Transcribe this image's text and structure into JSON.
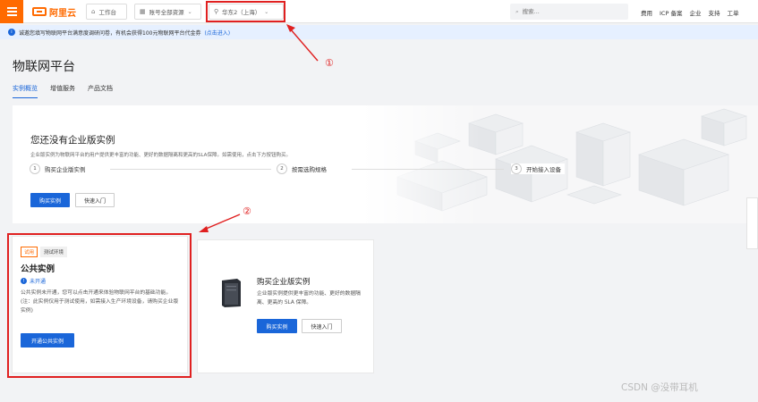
{
  "topbar": {
    "logo_text": "阿里云",
    "workbench": "工作台",
    "account_resources": "账号全部资源",
    "region": "华东2（上海）",
    "search_placeholder": "搜索...",
    "links": [
      "费用",
      "ICP 备案",
      "企业",
      "支持",
      "工单"
    ]
  },
  "notice": {
    "text": "诚邀您填写物联网平台满意度调研问卷，有机会获得100元物联网平台代金券",
    "link": "(点击进入)"
  },
  "page": {
    "title": "物联网平台",
    "tabs": [
      "实例概览",
      "增值服务",
      "产品文档"
    ]
  },
  "banner": {
    "title": "您还没有企业版实例",
    "desc": "企业版实例为物联网平台的用户提供更丰富的功能、更好的数据隔离和更高的SLA保障。如需使用，点击下方按钮购买。",
    "steps": [
      {
        "num": "1",
        "label": "购买企业版实例"
      },
      {
        "num": "2",
        "label": "按需选购规格"
      },
      {
        "num": "3",
        "label": "开始接入设备"
      }
    ],
    "buy_button": "购买实例",
    "quickstart_button": "快速入门"
  },
  "public_card": {
    "tag_trial": "试用",
    "tag_env": "测试环境",
    "title": "公共实例",
    "status": "未开通",
    "desc": "公共实例未开通，您可以点击开通来体验物联网平台的基础功能。(注：此实例仅用于测试使用，如需接入生产环境设备，请购买企业版实例)",
    "open_button": "开通公共实例"
  },
  "enterprise_card": {
    "title": "购买企业版实例",
    "desc": "企业版实例提供更丰富的功能、更好的数据隔离、更高的 SLA 保障。",
    "buy_button": "购买实例",
    "quickstart_button": "快速入门"
  },
  "annotations": {
    "one": "①",
    "two": "②"
  },
  "watermark": "CSDN @没带耳机",
  "colors": {
    "brand": "#ff6a00",
    "primary": "#1a66d9",
    "annotation": "#e02020"
  }
}
